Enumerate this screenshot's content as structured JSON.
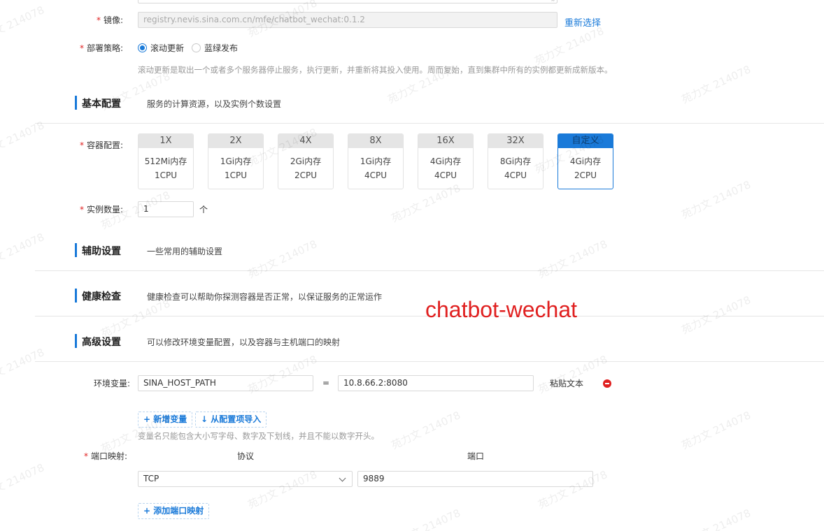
{
  "image_field": {
    "label": "镜像:",
    "value": "registry.nevis.sina.com.cn/mfe/chatbot_wechat:0.1.2",
    "reselect_link": "重新选择"
  },
  "deploy_strategy": {
    "label": "部署策略:",
    "options": [
      "滚动更新",
      "蓝绿发布"
    ],
    "selected": "滚动更新",
    "hint": "滚动更新是取出一个或者多个服务器停止服务，执行更新，并重新将其投入使用。周而复始，直到集群中所有的实例都更新成新版本。"
  },
  "basic_config": {
    "title": "基本配置",
    "desc": "服务的计算资源，以及实例个数设置"
  },
  "container_config": {
    "label": "容器配置:",
    "options": [
      {
        "name": "1X",
        "memory": "512Mi内存",
        "cpu": "1CPU"
      },
      {
        "name": "2X",
        "memory": "1Gi内存",
        "cpu": "1CPU"
      },
      {
        "name": "4X",
        "memory": "2Gi内存",
        "cpu": "2CPU"
      },
      {
        "name": "8X",
        "memory": "1Gi内存",
        "cpu": "4CPU"
      },
      {
        "name": "16X",
        "memory": "4Gi内存",
        "cpu": "4CPU"
      },
      {
        "name": "32X",
        "memory": "8Gi内存",
        "cpu": "4CPU"
      },
      {
        "name": "自定义",
        "memory": "4Gi内存",
        "cpu": "2CPU"
      }
    ],
    "selected": "自定义"
  },
  "instance_count": {
    "label": "实例数量:",
    "value": "1",
    "unit": "个"
  },
  "aux_settings": {
    "title": "辅助设置",
    "desc": "一些常用的辅助设置"
  },
  "health_check": {
    "title": "健康检查",
    "desc": "健康检查可以帮助你探测容器是否正常，以保证服务的正常运作"
  },
  "overlay_label": "chatbot-wechat",
  "advanced_settings": {
    "title": "高级设置",
    "desc": "可以修改环境变量配置，以及容器与主机端口的映射"
  },
  "env_vars": {
    "label": "环境变量:",
    "rows": [
      {
        "key": "SINA_HOST_PATH",
        "eq": "=",
        "value": "10.8.66.2:8080",
        "paste": "粘贴文本"
      }
    ],
    "add_button": "+ 新增变量",
    "import_button": "↓ 从配置项导入",
    "hint": "变量名只能包含大小写字母、数字及下划线，并且不能以数字开头。"
  },
  "port_mapping": {
    "label": "端口映射:",
    "col_protocol": "协议",
    "col_port": "端口",
    "rows": [
      {
        "protocol": "TCP",
        "port": "9889"
      }
    ],
    "add_button": "+ 添加端口映射"
  },
  "watermark": "苑力文 214078",
  "colors": {
    "accent": "#1a7ad9",
    "required": "#e02020",
    "overlay_text": "#e02020"
  },
  "icons": [
    "chevron-down-icon",
    "remove-circle-icon",
    "resize-handle-icon"
  ]
}
